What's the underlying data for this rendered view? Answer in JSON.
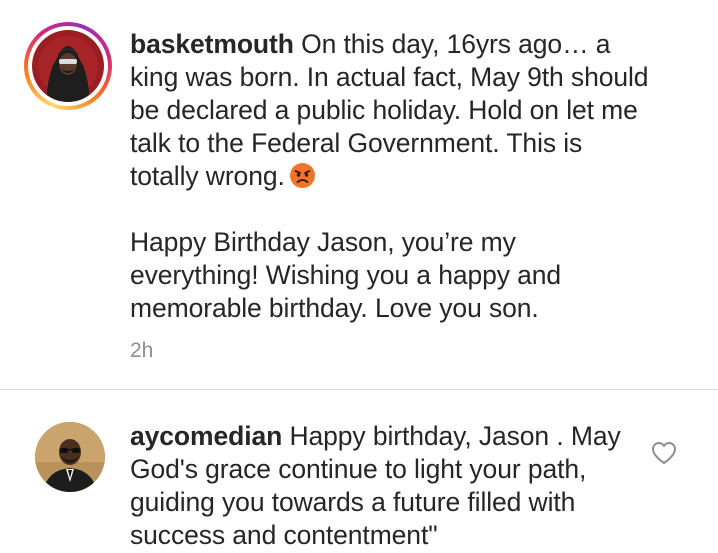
{
  "comments": [
    {
      "username": "basketmouth",
      "paragraphs": [
        "On this day, 16yrs ago… a king was born. In actual fact, May 9th should be declared a public holiday. Hold on let me talk to the Federal Government. This is totally wrong.",
        "Happy Birthday Jason, you’re my everything! Wishing you a happy and memorable birthday. Love you son."
      ],
      "emoji": "angry-face-emoji",
      "time": "2h",
      "has_story_ring": true
    },
    {
      "username": "aycomedian",
      "text": "Happy birthday, Jason . May God's grace continue to light your path, guiding you towards a future filled with success and contentment\"",
      "like_icon": "heart-outline-icon",
      "has_story_ring": false
    }
  ]
}
